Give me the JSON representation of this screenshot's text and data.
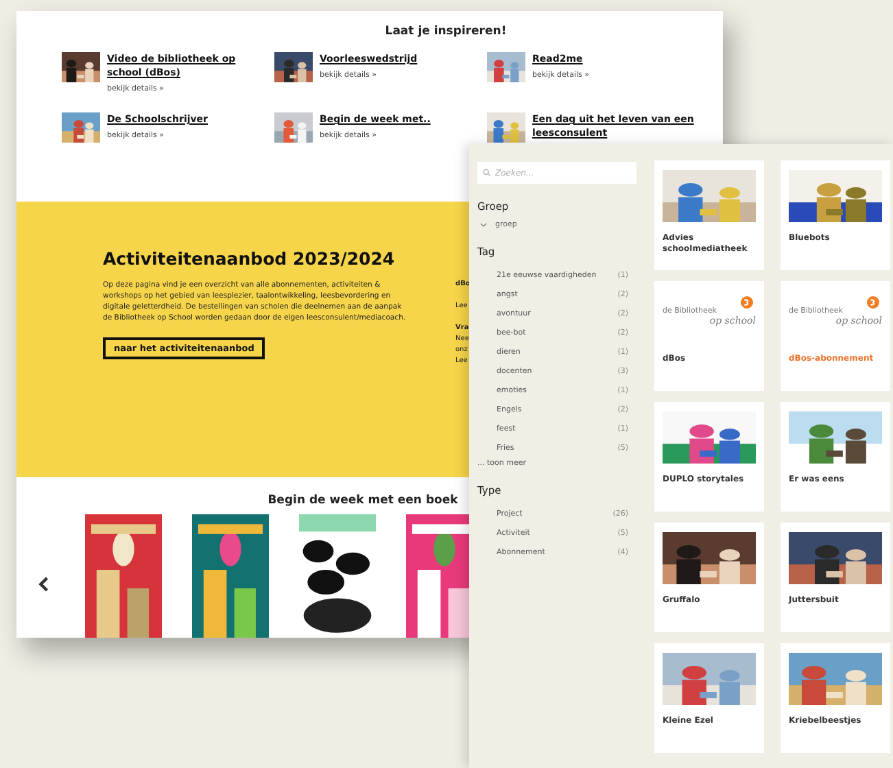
{
  "inspiration": {
    "title": "Laat je inspireren!",
    "items": [
      {
        "title": "Video de bibliotheek op school (dBos)",
        "link": "bekijk details »"
      },
      {
        "title": "Voorleeswedstrijd",
        "link": "bekijk details »"
      },
      {
        "title": "Read2me",
        "link": "bekijk details »"
      },
      {
        "title": "De Schoolschrijver",
        "link": "bekijk details »"
      },
      {
        "title": "Begin de week met..",
        "link": "bekijk details »"
      },
      {
        "title": "Een dag uit het leven van een leesconsulent"
      }
    ]
  },
  "offer": {
    "heading": "Activiteitenaanbod 2023/2024",
    "text": "Op deze pagina vind je een overzicht van alle abonnementen, activiteiten & workshops op het gebied van leesplezier, taalontwikkeling, leesbevordering en digitale geletterdheid. De bestellingen van scholen die deelnemen aan de aanpak de Bibliotheek op School worden gedaan door de eigen leesconsulent/mediacoach.",
    "button": "naar het activiteitenaanbod",
    "aside_fragments": [
      "dBo",
      "Lee",
      "Vra",
      "Nee",
      "onz",
      "Lee"
    ]
  },
  "books": {
    "title": "Begin de week met een boek"
  },
  "filters": {
    "search_placeholder": "Zoeken...",
    "sections": [
      {
        "title": "Groep",
        "kind": "group",
        "items": [
          {
            "label": "groep"
          }
        ]
      },
      {
        "title": "Tag",
        "kind": "list",
        "more": "... toon meer",
        "items": [
          {
            "label": "21e eeuwse vaardigheden",
            "count": "(1)"
          },
          {
            "label": "angst",
            "count": "(2)"
          },
          {
            "label": "avontuur",
            "count": "(2)"
          },
          {
            "label": "bee-bot",
            "count": "(2)"
          },
          {
            "label": "dieren",
            "count": "(1)"
          },
          {
            "label": "docenten",
            "count": "(3)"
          },
          {
            "label": "emoties",
            "count": "(1)"
          },
          {
            "label": "Engels",
            "count": "(2)"
          },
          {
            "label": "feest",
            "count": "(1)"
          },
          {
            "label": "Fries",
            "count": "(5)"
          }
        ]
      },
      {
        "title": "Type",
        "kind": "list",
        "items": [
          {
            "label": "Project",
            "count": "(26)"
          },
          {
            "label": "Activiteit",
            "count": "(5)"
          },
          {
            "label": "Abonnement",
            "count": "(4)"
          }
        ]
      }
    ]
  },
  "cards": [
    {
      "title": "Advies schoolmediatheek",
      "color": "#333333"
    },
    {
      "title": "Bluebots",
      "color": "#333333"
    },
    {
      "title": "dBos",
      "kind": "logo",
      "logo": [
        "de Bibliotheek",
        "op school"
      ],
      "color": "#333333"
    },
    {
      "title": "dBos-abonnement",
      "kind": "logo",
      "logo": [
        "de Bibliotheek",
        "op school"
      ],
      "color": "#e8732a"
    },
    {
      "title": "DUPLO storytales",
      "color": "#333333"
    },
    {
      "title": "Er was eens",
      "color": "#333333"
    },
    {
      "title": "Gruffalo",
      "color": "#333333"
    },
    {
      "title": "Juttersbuit",
      "color": "#333333"
    },
    {
      "title": "Kleine Ezel",
      "color": "#333333"
    },
    {
      "title": "Kriebelbeestjes",
      "color": "#333333"
    }
  ]
}
